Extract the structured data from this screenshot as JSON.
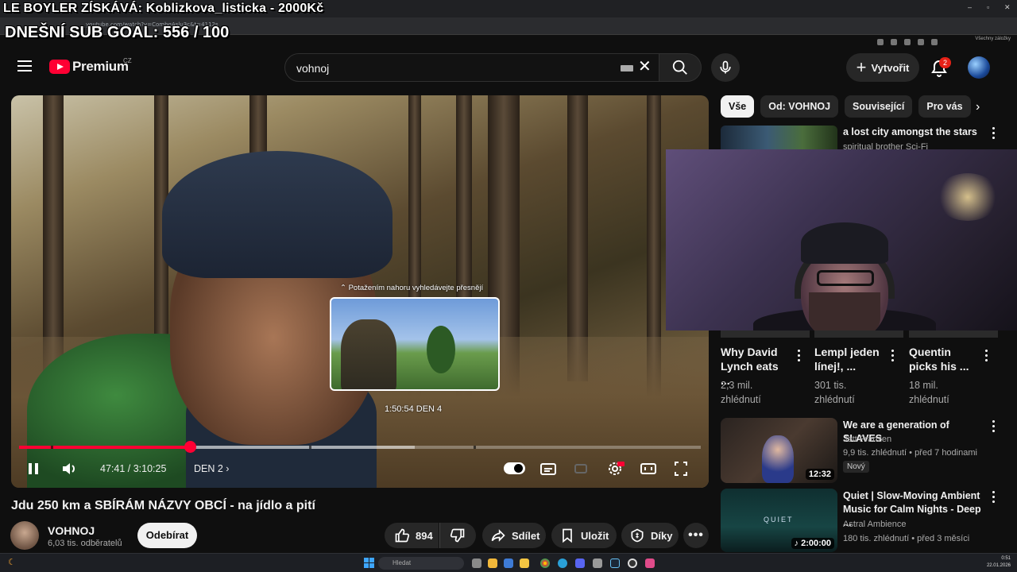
{
  "overlay": {
    "line1": "LE BOYLER ZÍSKÁVÁ: Koblizkova_listicka - 2000Kč",
    "line2": "DNEŠNÍ SUB GOAL: 556 / 100"
  },
  "browser": {
    "url": "youtube.com/watch?v=CombqAslu3c&t=4112s",
    "bookmarks": "Všechny záložky"
  },
  "header": {
    "logo_text": "Premium",
    "country": "CZ",
    "search_value": "vohnoj",
    "create_label": "Vytvořit",
    "notif_count": "2"
  },
  "player": {
    "swipe_hint": "⌃ Potažením nahoru vyhledávejte přesnějí",
    "preview_time": "1:50:54   DEN 4",
    "time": "47:41 / 3:10:25",
    "chapter": "DEN 2",
    "progress": 0.25,
    "hd_badge": "HD"
  },
  "video": {
    "title": "Jdu 250 km a SBÍRÁM NÁZVY OBCÍ - na jídlo a pití",
    "channel": "VOHNOJ",
    "subscribers": "6,03 tis. odběratelů",
    "subscribe_label": "Odebírat",
    "likes": "894",
    "share_label": "Sdílet",
    "save_label": "Uložit",
    "thanks_label": "Díky"
  },
  "chips": [
    "Vše",
    "Od: VOHNOJ",
    "Související",
    "Pro vás"
  ],
  "recommendations": {
    "top": {
      "title": "a lost city amongst the stars",
      "channel": "spiritual brother Sci-Fi"
    },
    "grid": [
      {
        "title": "Why David Lynch eats ...",
        "views": "2,3 mil.",
        "suffix": "zhlédnutí"
      },
      {
        "title": "Lempl jeden línej!, ...",
        "views": "301 tis.",
        "suffix": "zhlédnutí"
      },
      {
        "title": "Quentin picks his ...",
        "views": "18 mil.",
        "suffix": "zhlédnutí"
      }
    ],
    "list": [
      {
        "title": "We are a generation of SLAVES",
        "channel": "Jett Franzen",
        "meta": "9,9 tis. zhlédnutí • před 7 hodinami",
        "badge": "Nový",
        "duration": "12:32"
      },
      {
        "title": "Quiet | Slow-Moving Ambient Music for Calm Nights - Deep ...",
        "channel": "Astral Ambience",
        "meta": "180 tis. zhlédnutí • před 3 měsíci",
        "duration": "2:00:00"
      }
    ]
  },
  "taskbar": {
    "search_placeholder": "Hledat",
    "clock": "0:51",
    "date": "22.01.2026"
  }
}
